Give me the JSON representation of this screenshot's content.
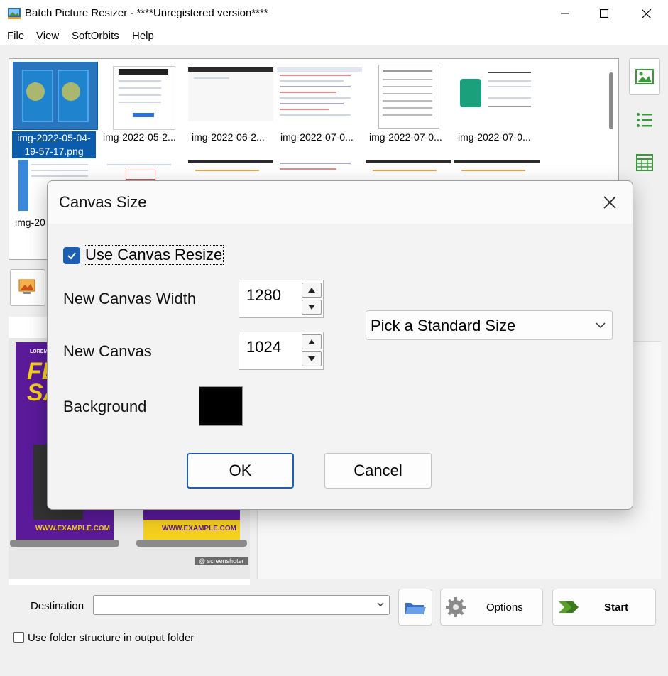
{
  "window": {
    "title": "Batch Picture Resizer - ****Unregistered version****"
  },
  "menu": {
    "items": [
      "File",
      "View",
      "SoftOrbits",
      "Help"
    ]
  },
  "thumbnails": {
    "row1": [
      {
        "label_line1": "img-2022-05-04-",
        "label_line2": "19-57-17.png"
      },
      {
        "label_line1": "img-2022-05-2..."
      },
      {
        "label_line1": "img-2022-06-2..."
      },
      {
        "label_line1": "img-2022-07-0..."
      },
      {
        "label_line1": "img-2022-07-0..."
      },
      {
        "label_line1": "img-2022-07-0..."
      }
    ],
    "row2_first_label": "img-20"
  },
  "preview": {
    "poster_text": "FLASH SALE",
    "url_text": "WWW.EXAMPLE.COM",
    "watermark": "@ screenshoter",
    "lorem": "LOREM IPSUM"
  },
  "bottom": {
    "destination_label": "Destination",
    "destination_value": "",
    "options_label": "Options",
    "start_label": "Start",
    "folder_structure_label": "Use folder structure in output folder",
    "folder_structure_checked": false
  },
  "dialog": {
    "title": "Canvas Size",
    "use_canvas_resize_label": "Use Canvas Resize",
    "use_canvas_resize_checked": true,
    "width_label": "New Canvas Width",
    "width_value": "1280",
    "height_label": "New Canvas",
    "height_value": "1024",
    "standard_size_label": "Pick a Standard Size",
    "background_label": "Background",
    "background_color": "#000000",
    "ok_label": "OK",
    "cancel_label": "Cancel"
  },
  "colors": {
    "accent": "#1a5fb4",
    "selection": "#0b5cad"
  }
}
